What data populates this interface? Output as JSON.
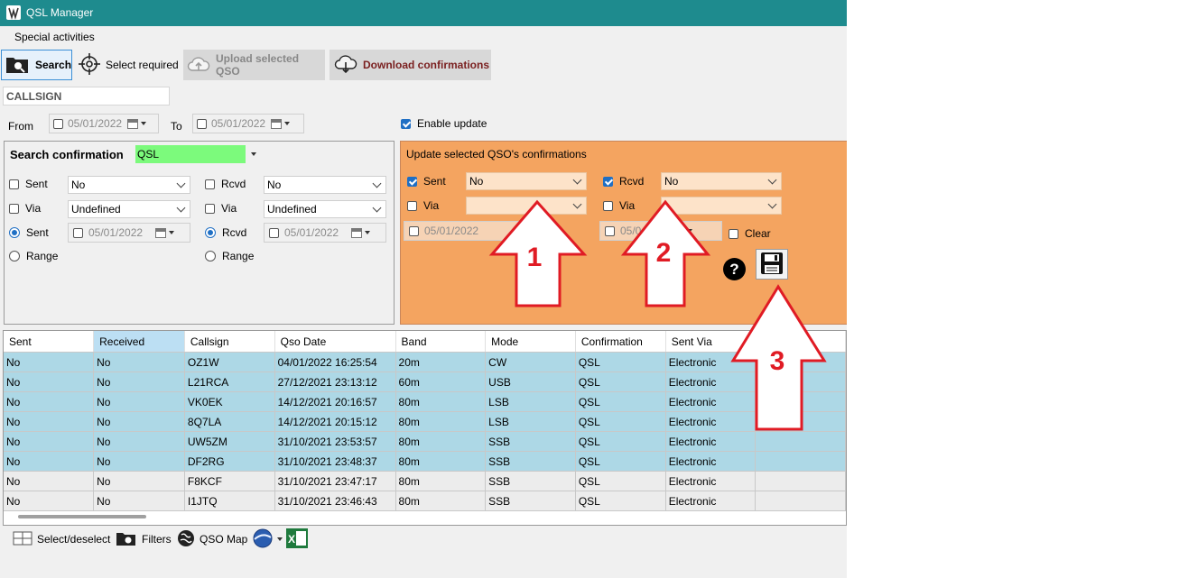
{
  "window": {
    "title": "QSL Manager"
  },
  "menu": {
    "items": [
      "Special activities"
    ]
  },
  "toolbar": {
    "search": "Search",
    "select_required": "Select required",
    "upload": "Upload selected QSO",
    "download": "Download confirmations"
  },
  "callsign_field": {
    "value": "CALLSIGN"
  },
  "date_range": {
    "from_label": "From",
    "from_value": "05/01/2022",
    "to_label": "To",
    "to_value": "05/01/2022"
  },
  "enable_update": {
    "label": "Enable update",
    "checked": true
  },
  "search_panel": {
    "title": "Search confirmation",
    "confirmation_type": "QSL",
    "sent_label": "Sent",
    "sent_value": "No",
    "rcvd_label": "Rcvd",
    "rcvd_value": "No",
    "via_label": "Via",
    "via_value_left": "Undefined",
    "via_value_right": "Undefined",
    "radio_sent_label": "Sent",
    "radio_rcvd_label": "Rcvd",
    "range_label": "Range",
    "date_left": "05/01/2022",
    "date_right": "05/01/2022"
  },
  "update_panel": {
    "title": "Update selected QSO's confirmations",
    "sent_label": "Sent",
    "sent_value": "No",
    "rcvd_label": "Rcvd",
    "rcvd_value": "No",
    "via_label": "Via",
    "date_left": "05/01/2022",
    "date_right": "05/0",
    "clear_partial": "ar",
    "clear_label": "Clear",
    "help_glyph": "?"
  },
  "grid": {
    "columns": [
      "Sent",
      "Received",
      "Callsign",
      "Qso Date",
      "Band",
      "Mode",
      "Confirmation",
      "Sent Via"
    ],
    "rows": [
      [
        "No",
        "No",
        "OZ1W",
        "04/01/2022 16:25:54",
        "20m",
        "CW",
        "QSL",
        "Electronic"
      ],
      [
        "No",
        "No",
        "L21RCA",
        "27/12/2021 23:13:12",
        "60m",
        "USB",
        "QSL",
        "Electronic"
      ],
      [
        "No",
        "No",
        "VK0EK",
        "14/12/2021 20:16:57",
        "80m",
        "LSB",
        "QSL",
        "Electronic"
      ],
      [
        "No",
        "No",
        "8Q7LA",
        "14/12/2021 20:15:12",
        "80m",
        "LSB",
        "QSL",
        "Electronic"
      ],
      [
        "No",
        "No",
        "UW5ZM",
        "31/10/2021 23:53:57",
        "80m",
        "SSB",
        "QSL",
        "Electronic"
      ],
      [
        "No",
        "No",
        "DF2RG",
        "31/10/2021 23:48:37",
        "80m",
        "SSB",
        "QSL",
        "Electronic"
      ],
      [
        "No",
        "No",
        "F8KCF",
        "31/10/2021 23:47:17",
        "80m",
        "SSB",
        "QSL",
        "Electronic"
      ],
      [
        "No",
        "No",
        "I1JTQ",
        "31/10/2021 23:46:43",
        "80m",
        "SSB",
        "QSL",
        "Electronic"
      ]
    ]
  },
  "statusbar": {
    "select_deselect": "Select/deselect",
    "filters": "Filters",
    "qso_map": "QSO Map"
  },
  "annotations": {
    "arrow1": "1",
    "arrow2": "2",
    "arrow3": "3"
  },
  "colors": {
    "title_bar": "#1e8b8e",
    "update_panel": "#f4a460",
    "qsl_highlight": "#7cfa7c",
    "row_highlight": "#add8e6",
    "arrow_red": "#e01b24"
  }
}
